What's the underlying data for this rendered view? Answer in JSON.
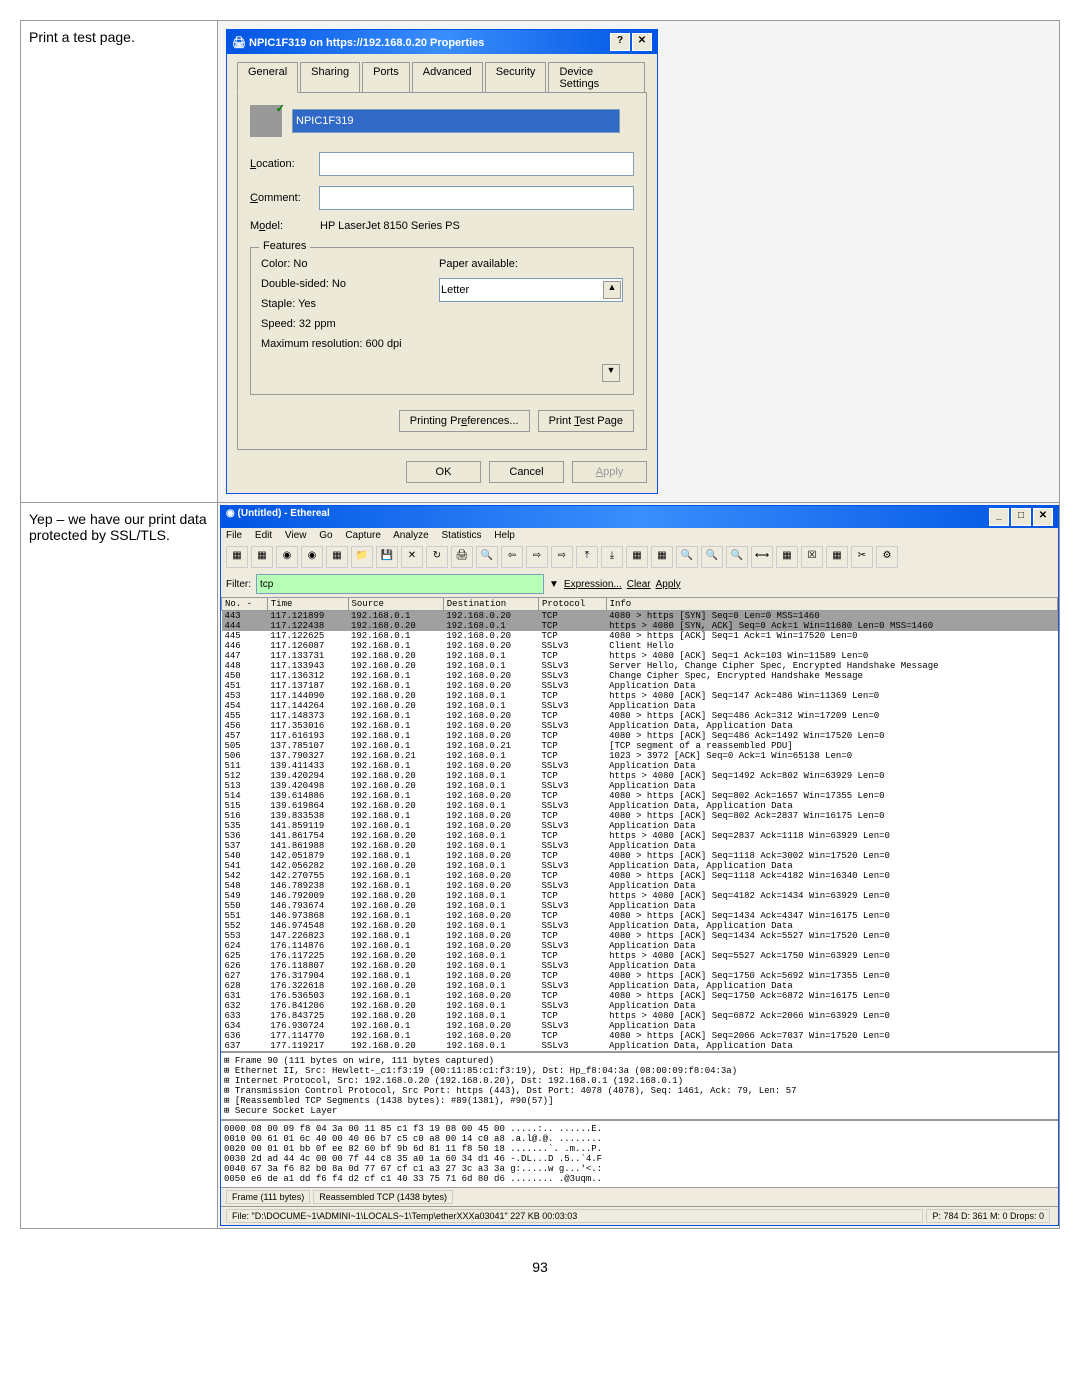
{
  "page_number": "93",
  "section1": {
    "label": "Print a test page.",
    "dialog": {
      "title": "NPIC1F319 on https://192.168.0.20 Properties",
      "tabs": [
        "General",
        "Sharing",
        "Ports",
        "Advanced",
        "Security",
        "Device Settings"
      ],
      "printer_name": "NPIC1F319",
      "location_label": "Location:",
      "comment_label": "Comment:",
      "model_label": "Model:",
      "model_value": "HP LaserJet 8150 Series PS",
      "features_legend": "Features",
      "color_line": "Color: No",
      "double_line": "Double-sided: No",
      "staple_line": "Staple: Yes",
      "speed_line": "Speed: 32 ppm",
      "res_line": "Maximum resolution: 600 dpi",
      "paper_label": "Paper available:",
      "paper_value": "Letter",
      "btn_prefs": "Printing Preferences...",
      "btn_test": "Print Test Page",
      "btn_ok": "OK",
      "btn_cancel": "Cancel",
      "btn_apply": "Apply"
    }
  },
  "section2": {
    "label": "Yep – we have our print data protected by SSL/TLS.",
    "eth": {
      "title": "(Untitled) - Ethereal",
      "menu": [
        "File",
        "Edit",
        "View",
        "Go",
        "Capture",
        "Analyze",
        "Statistics",
        "Help"
      ],
      "filter_label": "Filter:",
      "filter_value": "tcp",
      "btn_expr": "Expression...",
      "btn_clear": "Clear",
      "btn_apply": "Apply",
      "cols": [
        "No. -",
        "Time",
        "Source",
        "Destination",
        "Protocol",
        "Info"
      ],
      "packets": [
        [
          "443",
          "117.121899",
          "192.168.0.1",
          "192.168.0.20",
          "TCP",
          "4080 > https [SYN] Seq=0 Len=0 MSS=1460"
        ],
        [
          "444",
          "117.122438",
          "192.168.0.20",
          "192.168.0.1",
          "TCP",
          "https > 4080 [SYN, ACK] Seq=0 Ack=1 Win=11680 Len=0 MSS=1460"
        ],
        [
          "445",
          "117.122625",
          "192.168.0.1",
          "192.168.0.20",
          "TCP",
          "4080 > https [ACK] Seq=1 Ack=1 Win=17520 Len=0"
        ],
        [
          "446",
          "117.126087",
          "192.168.0.1",
          "192.168.0.20",
          "SSLv3",
          "Client Hello"
        ],
        [
          "447",
          "117.133731",
          "192.168.0.20",
          "192.168.0.1",
          "TCP",
          "https > 4080 [ACK] Seq=1 Ack=103 Win=11589 Len=0"
        ],
        [
          "448",
          "117.133943",
          "192.168.0.20",
          "192.168.0.1",
          "SSLv3",
          "Server Hello, Change Cipher Spec, Encrypted Handshake Message"
        ],
        [
          "450",
          "117.136312",
          "192.168.0.1",
          "192.168.0.20",
          "SSLv3",
          "Change Cipher Spec, Encrypted Handshake Message"
        ],
        [
          "451",
          "117.137187",
          "192.168.0.1",
          "192.168.0.20",
          "SSLv3",
          "Application Data"
        ],
        [
          "453",
          "117.144090",
          "192.168.0.20",
          "192.168.0.1",
          "TCP",
          "https > 4080 [ACK] Seq=147 Ack=486 Win=11369 Len=0"
        ],
        [
          "454",
          "117.144264",
          "192.168.0.20",
          "192.168.0.1",
          "SSLv3",
          "Application Data"
        ],
        [
          "455",
          "117.148373",
          "192.168.0.1",
          "192.168.0.20",
          "TCP",
          "4080 > https [ACK] Seq=486 Ack=312 Win=17209 Len=0"
        ],
        [
          "456",
          "117.353016",
          "192.168.0.1",
          "192.168.0.20",
          "SSLv3",
          "Application Data, Application Data"
        ],
        [
          "457",
          "117.616193",
          "192.168.0.1",
          "192.168.0.20",
          "TCP",
          "4080 > https [ACK] Seq=486 Ack=1492 Win=17520 Len=0"
        ],
        [
          "505",
          "137.785107",
          "192.168.0.1",
          "192.168.0.21",
          "TCP",
          "[TCP segment of a reassembled PDU]"
        ],
        [
          "506",
          "137.790327",
          "192.168.0.21",
          "192.168.0.1",
          "TCP",
          "1023 > 3972 [ACK] Seq=0 Ack=1 Win=65138 Len=0"
        ],
        [
          "511",
          "139.411433",
          "192.168.0.1",
          "192.168.0.20",
          "SSLv3",
          "Application Data"
        ],
        [
          "512",
          "139.420294",
          "192.168.0.20",
          "192.168.0.1",
          "TCP",
          "https > 4080 [ACK] Seq=1492 Ack=802 Win=63929 Len=0"
        ],
        [
          "513",
          "139.420498",
          "192.168.0.20",
          "192.168.0.1",
          "SSLv3",
          "Application Data"
        ],
        [
          "514",
          "139.614886",
          "192.168.0.1",
          "192.168.0.20",
          "TCP",
          "4080 > https [ACK] Seq=802 Ack=1657 Win=17355 Len=0"
        ],
        [
          "515",
          "139.619864",
          "192.168.0.20",
          "192.168.0.1",
          "SSLv3",
          "Application Data, Application Data"
        ],
        [
          "516",
          "139.833538",
          "192.168.0.1",
          "192.168.0.20",
          "TCP",
          "4080 > https [ACK] Seq=802 Ack=2837 Win=16175 Len=0"
        ],
        [
          "535",
          "141.859119",
          "192.168.0.1",
          "192.168.0.20",
          "SSLv3",
          "Application Data"
        ],
        [
          "536",
          "141.861754",
          "192.168.0.20",
          "192.168.0.1",
          "TCP",
          "https > 4080 [ACK] Seq=2837 Ack=1118 Win=63929 Len=0"
        ],
        [
          "537",
          "141.861988",
          "192.168.0.20",
          "192.168.0.1",
          "SSLv3",
          "Application Data"
        ],
        [
          "540",
          "142.051879",
          "192.168.0.1",
          "192.168.0.20",
          "TCP",
          "4080 > https [ACK] Seq=1118 Ack=3002 Win=17520 Len=0"
        ],
        [
          "541",
          "142.056282",
          "192.168.0.20",
          "192.168.0.1",
          "SSLv3",
          "Application Data, Application Data"
        ],
        [
          "542",
          "142.270755",
          "192.168.0.1",
          "192.168.0.20",
          "TCP",
          "4080 > https [ACK] Seq=1118 Ack=4182 Win=16340 Len=0"
        ],
        [
          "548",
          "146.789238",
          "192.168.0.1",
          "192.168.0.20",
          "SSLv3",
          "Application Data"
        ],
        [
          "549",
          "146.792009",
          "192.168.0.20",
          "192.168.0.1",
          "TCP",
          "https > 4080 [ACK] Seq=4182 Ack=1434 Win=63929 Len=0"
        ],
        [
          "550",
          "146.793674",
          "192.168.0.20",
          "192.168.0.1",
          "SSLv3",
          "Application Data"
        ],
        [
          "551",
          "146.973868",
          "192.168.0.1",
          "192.168.0.20",
          "TCP",
          "4080 > https [ACK] Seq=1434 Ack=4347 Win=16175 Len=0"
        ],
        [
          "552",
          "146.974548",
          "192.168.0.20",
          "192.168.0.1",
          "SSLv3",
          "Application Data, Application Data"
        ],
        [
          "553",
          "147.226823",
          "192.168.0.1",
          "192.168.0.20",
          "TCP",
          "4080 > https [ACK] Seq=1434 Ack=5527 Win=17520 Len=0"
        ],
        [
          "624",
          "176.114876",
          "192.168.0.1",
          "192.168.0.20",
          "SSLv3",
          "Application Data"
        ],
        [
          "625",
          "176.117225",
          "192.168.0.20",
          "192.168.0.1",
          "TCP",
          "https > 4080 [ACK] Seq=5527 Ack=1750 Win=63929 Len=0"
        ],
        [
          "626",
          "176.118807",
          "192.168.0.20",
          "192.168.0.1",
          "SSLv3",
          "Application Data"
        ],
        [
          "627",
          "176.317904",
          "192.168.0.1",
          "192.168.0.20",
          "TCP",
          "4080 > https [ACK] Seq=1750 Ack=5692 Win=17355 Len=0"
        ],
        [
          "628",
          "176.322618",
          "192.168.0.20",
          "192.168.0.1",
          "SSLv3",
          "Application Data, Application Data"
        ],
        [
          "631",
          "176.536503",
          "192.168.0.1",
          "192.168.0.20",
          "TCP",
          "4080 > https [ACK] Seq=1750 Ack=6872 Win=16175 Len=0"
        ],
        [
          "632",
          "176.841206",
          "192.168.0.20",
          "192.168.0.1",
          "SSLv3",
          "Application Data"
        ],
        [
          "633",
          "176.843725",
          "192.168.0.20",
          "192.168.0.1",
          "TCP",
          "https > 4080 [ACK] Seq=6872 Ack=2066 Win=63929 Len=0"
        ],
        [
          "634",
          "176.930724",
          "192.168.0.1",
          "192.168.0.20",
          "SSLv3",
          "Application Data"
        ],
        [
          "636",
          "177.114770",
          "192.168.0.1",
          "192.168.0.20",
          "TCP",
          "4080 > https [ACK] Seq=2066 Ack=7037 Win=17520 Len=0"
        ],
        [
          "637",
          "177.119217",
          "192.168.0.20",
          "192.168.0.1",
          "SSLv3",
          "Application Data, Application Data"
        ]
      ],
      "details": [
        "⊞ Frame 90 (111 bytes on wire, 111 bytes captured)",
        "⊞ Ethernet II, Src: Hewlett-_c1:f3:19 (00:11:85:c1:f3:19), Dst: Hp_f8:04:3a (08:00:09:f8:04:3a)",
        "⊞ Internet Protocol, Src: 192.168.0.20 (192.168.0.20), Dst: 192.168.0.1 (192.168.0.1)",
        "⊞ Transmission Control Protocol, Src Port: https (443), Dst Port: 4078 (4078), Seq: 1461, Ack: 79, Len: 57",
        "⊞ [Reassembled TCP Segments (1438 bytes): #89(1381), #90(57)]",
        "⊞ Secure Socket Layer"
      ],
      "hex": [
        "0000  08 00 09 f8 04 3a 00 11  85 c1 f3 19 08 00 45 00   .....:.. ......E.",
        "0010  00 61 01 6c 40 00 40 06  b7 c5 c0 a8 00 14 c0 a8   .a.l@.@. ........",
        "0020  00 01 01 bb 0f ee 82 60  bf 9b 6d 81 11 f8 50 18   .......`. .m...P.",
        "0030  2d ad 44 4c 00 00 7f 44  c8 35 a0 1a 60 34 d1 46   -.DL...D .5..`4.F",
        "0040  67 3a f6 82 b0 8a 0d 77  67 cf c1 a3 27 3c a3 3a   g:.....w g...'<.:",
        "0050  e6 de a1 dd f6 f4 d2 cf  c1 40 33 75 71 6d 80 d6   ........ .@3uqm.."
      ],
      "status_tabs": [
        "Frame (111 bytes)",
        "Reassembled TCP (1438 bytes)"
      ],
      "status_file": "File: \"D:\\DOCUME~1\\ADMINI~1\\LOCALS~1\\Temp\\etherXXXa03041\" 227 KB 00:03:03",
      "status_pd": "P: 784 D: 361 M: 0 Drops: 0"
    }
  }
}
